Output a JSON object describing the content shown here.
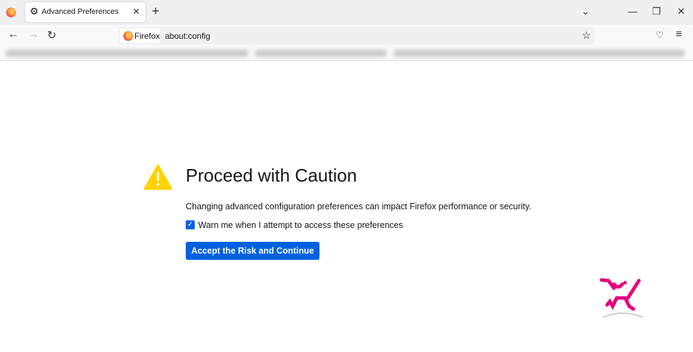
{
  "browser": {
    "tab_title": "Advanced Preferences",
    "identity_label": "Firefox",
    "url": "about:config"
  },
  "page": {
    "title": "Proceed with Caution",
    "description": "Changing advanced configuration preferences can impact Firefox performance or security.",
    "checkbox_label": "Warn me when I attempt to access these preferences",
    "checkbox_checked": true,
    "button_label": "Accept the Risk and Continue"
  },
  "colors": {
    "accent": "#0061e0",
    "warning": "#ffd200",
    "logo": "#e6007e"
  }
}
